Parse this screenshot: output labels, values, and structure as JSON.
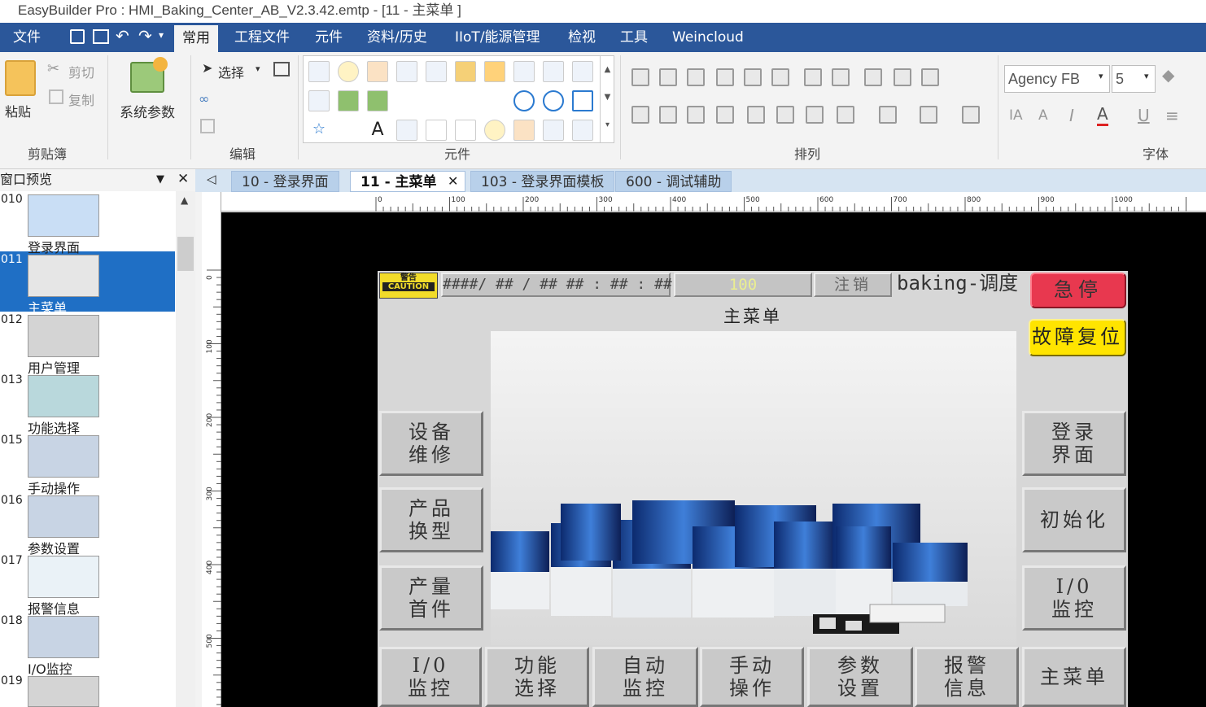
{
  "title_bar": {
    "title": "EasyBuilder Pro : HMI_Baking_Center_AB_V2.3.42.emtp - [11 - 主菜单 ]"
  },
  "menu": [
    "文件",
    "常用",
    "工程文件",
    "元件",
    "资料/历史",
    "IIoT/能源管理",
    "检视",
    "工具",
    "Weincloud"
  ],
  "ribbon": {
    "clipboard": {
      "paste": "粘贴",
      "cut": "剪切",
      "copy": "复制",
      "group": "剪贴簿"
    },
    "sysparam": "系统参数",
    "edit": {
      "select": "选择",
      "group": "编辑"
    },
    "elements_group": "元件",
    "arrange_group": "排列",
    "font": {
      "name": "Agency FB",
      "size": "5",
      "group": "字体"
    }
  },
  "panel": {
    "title": "窗口预览",
    "items": [
      {
        "num": "010",
        "label": "登录界面"
      },
      {
        "num": "011",
        "label": "主菜单"
      },
      {
        "num": "012",
        "label": "用户管理"
      },
      {
        "num": "013",
        "label": "功能选择"
      },
      {
        "num": "015",
        "label": "手动操作"
      },
      {
        "num": "016",
        "label": "参数设置"
      },
      {
        "num": "017",
        "label": "报警信息"
      },
      {
        "num": "018",
        "label": "I/O监控"
      },
      {
        "num": "019",
        "label": ""
      }
    ]
  },
  "tabs": [
    "10 - 登录界面",
    "11 - 主菜单",
    "103 - 登录界面模板",
    "600 - 调试辅助"
  ],
  "ruler": {
    "h_labels": [
      "0",
      "100",
      "200",
      "300",
      "400",
      "500",
      "600",
      "700",
      "800",
      "900",
      "1000"
    ],
    "v_labels": [
      "0",
      "100",
      "200",
      "300",
      "400",
      "500"
    ]
  },
  "hmi": {
    "caution_top": "警告",
    "caution": "CAUTION",
    "datetime": "####/ ## / ## ## : ## : ##",
    "value": "100",
    "logout": "注销",
    "station": "baking-调度",
    "estop": "急停",
    "screen_title": "主菜单",
    "reset": "故障复位",
    "left_buttons": [
      "设备\n维修",
      "产品\n换型",
      "产量\n首件"
    ],
    "right_buttons": [
      "登录\n界面",
      "初始化",
      "I/0\n监控"
    ],
    "bottom_buttons": [
      "I/0\n监控",
      "功能\n选择",
      "自动\n监控",
      "手动\n操作",
      "参数\n设置",
      "报警\n信息",
      "主菜单"
    ]
  },
  "colors": {
    "accent": "#2b579a",
    "selection": "#1f6fc5",
    "estop": "#e8384f",
    "reset": "#ffe400"
  }
}
